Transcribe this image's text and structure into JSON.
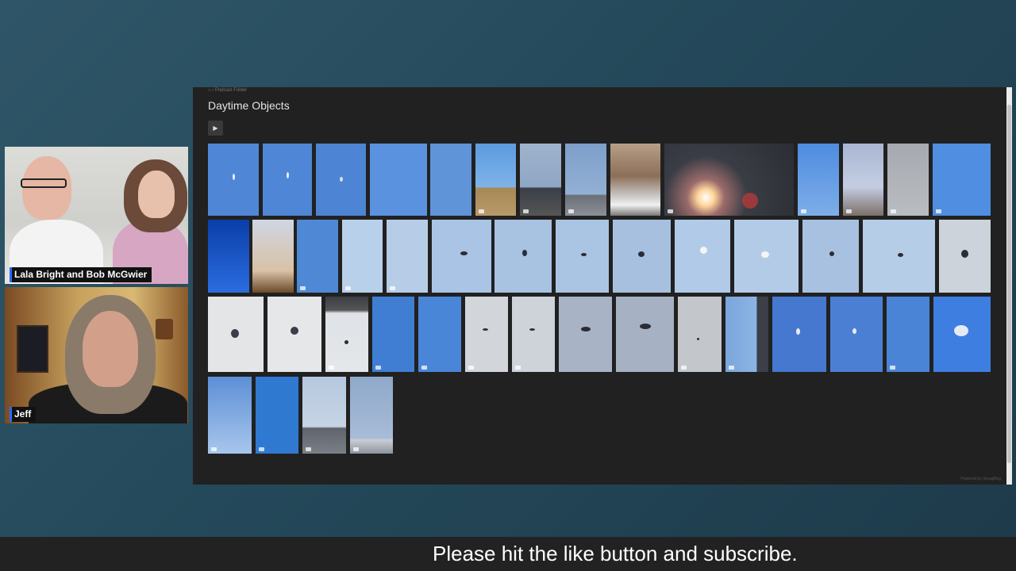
{
  "participants": [
    {
      "name": "Lala Bright and Bob McGwier"
    },
    {
      "name": "Jeff"
    }
  ],
  "gallery": {
    "breadcrumb": "⌂ › Podcast Folder",
    "title": "Daytime Objects",
    "play_icon": "play-icon",
    "play_glyph": "▶",
    "powered_by": "Powered by SmugMug"
  },
  "caption": "Please hit the like button and subscribe.",
  "colors": {
    "gallery_bg": "#212121",
    "sky_blue": "#4f88d8",
    "caption_bg": "#222222"
  }
}
